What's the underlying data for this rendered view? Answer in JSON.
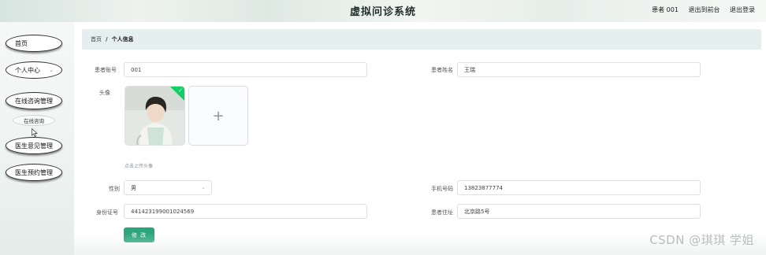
{
  "header": {
    "title": "虚拟问诊系统",
    "user": "患者 001",
    "back_label": "退出到前台",
    "logout_label": "退出登录"
  },
  "sidebar": {
    "home": "首页",
    "personal_center": "个人中心",
    "online_consult_mgmt": "在线咨询管理",
    "online_consult": "在线咨询",
    "doctor_opinion_mgmt": "医生意见管理",
    "doctor_booking_mgmt": "医生预约管理"
  },
  "breadcrumb": {
    "home": "首页",
    "separator": "/",
    "current": "个人信息"
  },
  "form": {
    "account_label": "患者账号",
    "account_value": "001",
    "name_label": "患者姓名",
    "name_value": "王瑞",
    "avatar_label": "头像",
    "upload_hint": "点击上传头像",
    "gender_label": "性别",
    "gender_value": "男",
    "phone_label": "手机号码",
    "phone_value": "13823877774",
    "id_label": "身份证号",
    "id_value": "441423199001024569",
    "address_label": "患者住址",
    "address_value": "北京路5号",
    "submit_label": "修 改"
  },
  "watermark": "CSDN @琪琪 学姐",
  "colors": {
    "accent": "#2ba57c",
    "success_badge": "#13ce66",
    "breadcrumb_bg": "#e6eff0"
  }
}
